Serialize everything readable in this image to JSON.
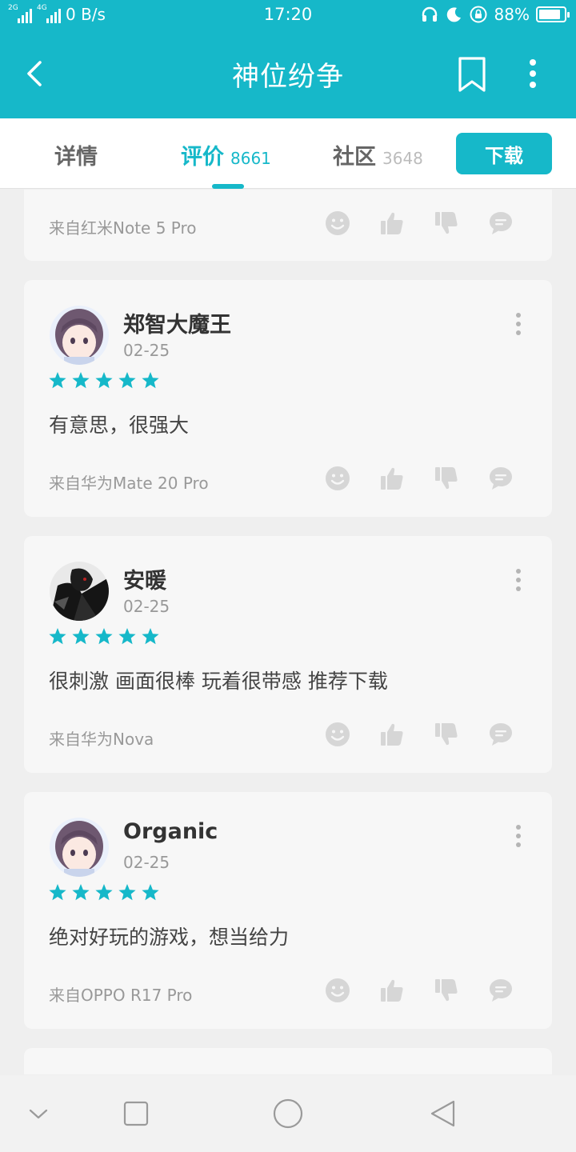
{
  "status_bar": {
    "sim1": "2G",
    "sim2": "4G",
    "net_speed": "0 B/s",
    "time": "17:20",
    "battery": "88%",
    "battery_level": 0.88,
    "icons": [
      "headphones-icon",
      "moon-icon",
      "rotation-lock-icon",
      "battery-icon"
    ]
  },
  "header": {
    "title": "神位纷争",
    "icons": [
      "back-arrow-icon",
      "bookmark-icon",
      "more-vertical-icon"
    ]
  },
  "tabs": [
    {
      "label": "详情",
      "count": ""
    },
    {
      "label": "评价",
      "count": "8661",
      "active": true
    },
    {
      "label": "社区",
      "count": "3648"
    }
  ],
  "download_label": "下载",
  "partial_review": {
    "device": "来自红米Note 5 Pro"
  },
  "reviews": [
    {
      "name": "郑智大魔王",
      "date": "02-25",
      "rating": 5,
      "text": "有意思，很强大",
      "device": "来自华为Mate 20 Pro"
    },
    {
      "name": "安暖",
      "date": "02-25",
      "rating": 5,
      "text": "很刺激 画面很棒 玩着很带感 推荐下载",
      "device": "来自华为Nova"
    },
    {
      "name": "Organic",
      "date": "02-25",
      "rating": 5,
      "text": "绝对好玩的游戏，想当给力",
      "device": "来自OPPO R17 Pro"
    }
  ],
  "action_icons": [
    "smile-icon",
    "thumbs-up-icon",
    "thumbs-down-icon",
    "comment-icon"
  ],
  "colors": {
    "accent": "#16b8c9",
    "card": "#f7f7f7",
    "icon_gray": "#d6d6d6"
  }
}
